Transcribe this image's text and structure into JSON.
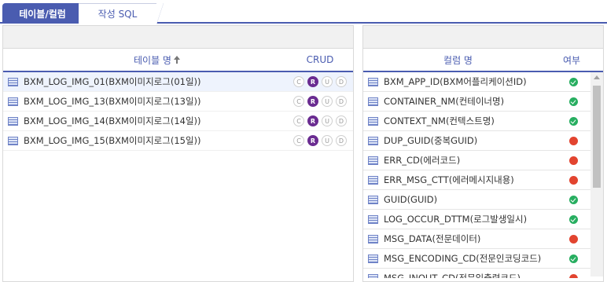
{
  "tabs": [
    {
      "label": "테이블/컬럼"
    },
    {
      "label": "작성 SQL"
    }
  ],
  "left": {
    "header_name": "테이블 명",
    "header_crud": "CRUD",
    "crud_letters": [
      "C",
      "R",
      "U",
      "D"
    ],
    "rows": [
      {
        "name": "BXM_LOG_IMG_01(BXM이미지로그(01일))",
        "crud_active": "R"
      },
      {
        "name": "BXM_LOG_IMG_13(BXM이미지로그(13일))",
        "crud_active": "R"
      },
      {
        "name": "BXM_LOG_IMG_14(BXM이미지로그(14일))",
        "crud_active": "R"
      },
      {
        "name": "BXM_LOG_IMG_15(BXM이미지로그(15일))",
        "crud_active": "R"
      }
    ]
  },
  "right": {
    "header_name": "컬럼 명",
    "header_status": "여부",
    "rows": [
      {
        "name": "BXM_APP_ID(BXM어플리케이션ID)",
        "status": "ok"
      },
      {
        "name": "CONTAINER_NM(컨테이너명)",
        "status": "ok"
      },
      {
        "name": "CONTEXT_NM(컨텍스트명)",
        "status": "ok"
      },
      {
        "name": "DUP_GUID(중복GUID)",
        "status": "bad"
      },
      {
        "name": "ERR_CD(에러코드)",
        "status": "bad"
      },
      {
        "name": "ERR_MSG_CTT(에러메시지내용)",
        "status": "bad"
      },
      {
        "name": "GUID(GUID)",
        "status": "ok"
      },
      {
        "name": "LOG_OCCUR_DTTM(로그발생일시)",
        "status": "ok"
      },
      {
        "name": "MSG_DATA(전문데이터)",
        "status": "bad"
      },
      {
        "name": "MSG_ENCODING_CD(전문인코딩코드)",
        "status": "ok"
      },
      {
        "name": "MSG_INOUT_CD(전문입출력코드)",
        "status": "bad"
      }
    ]
  },
  "colors": {
    "accent": "#4a5cb0",
    "crud_on": "#6a2c91",
    "ok": "#27ae60",
    "bad": "#e2442f"
  }
}
